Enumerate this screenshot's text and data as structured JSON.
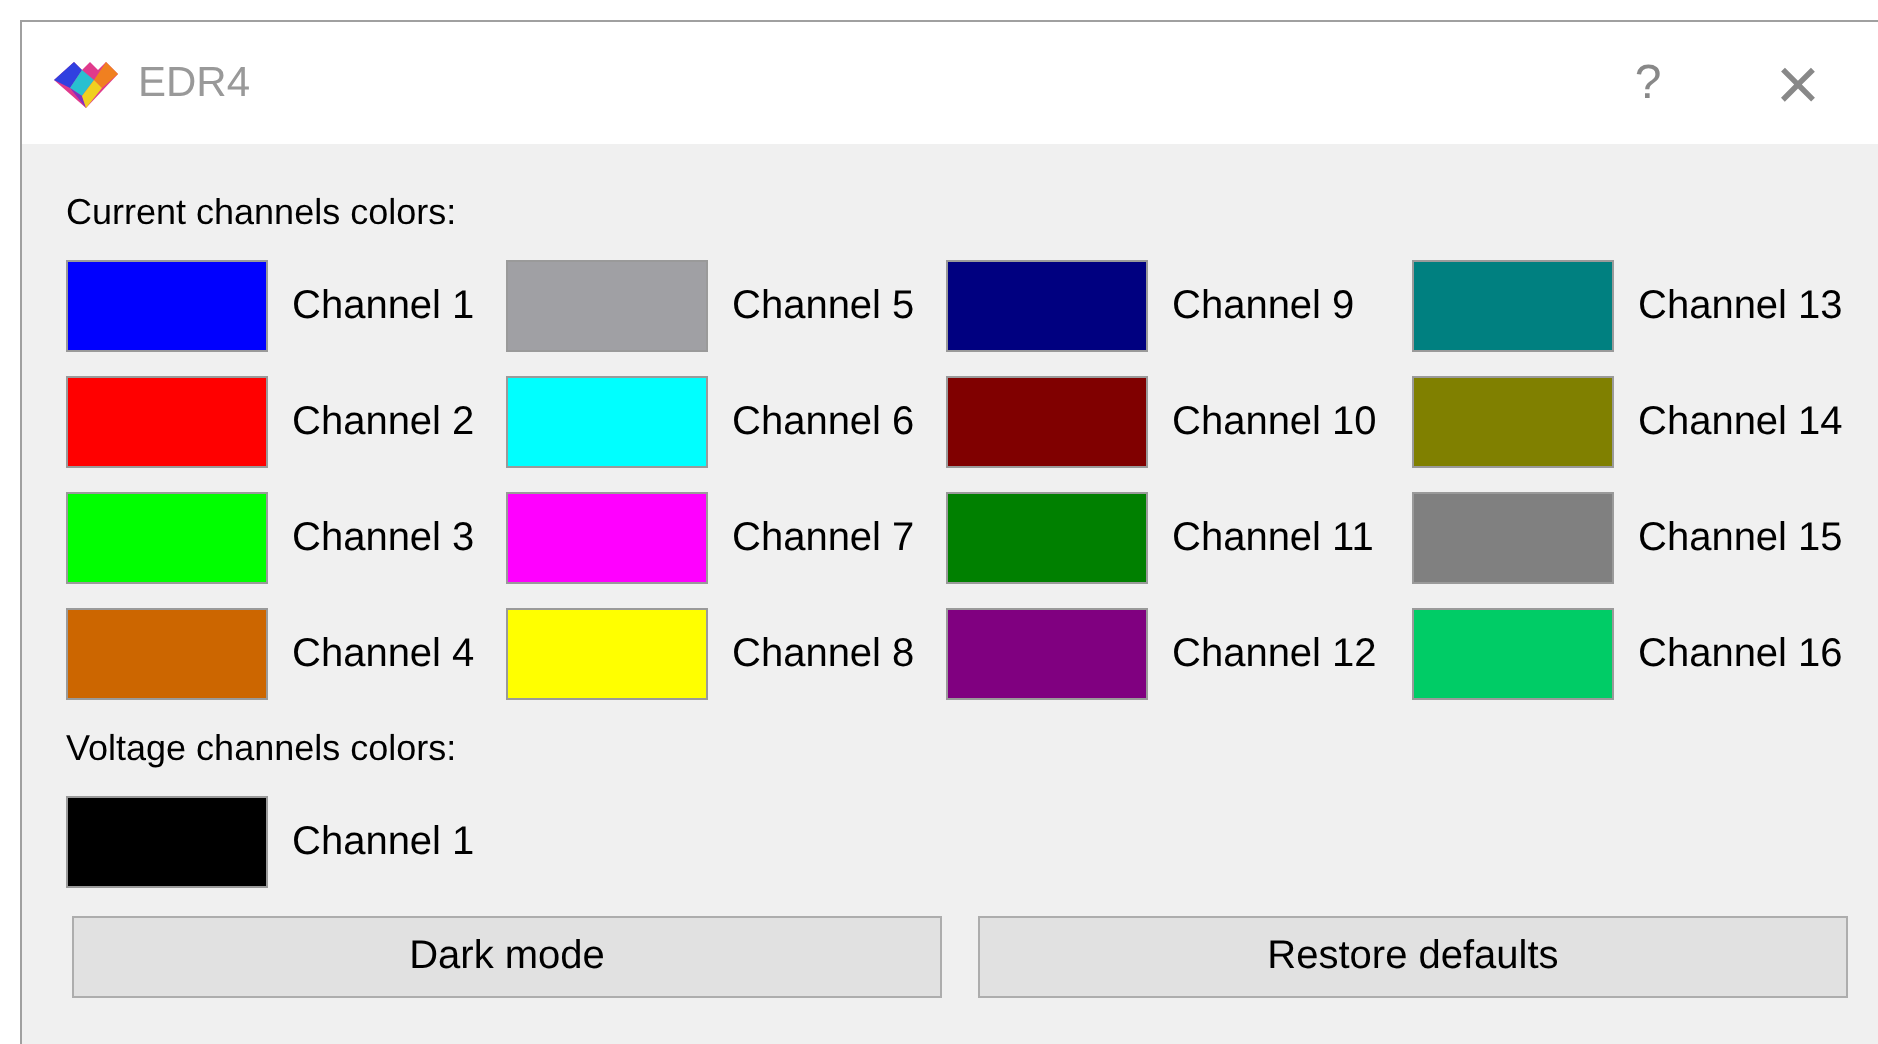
{
  "window": {
    "title": "EDR4",
    "help": "?",
    "close": "×"
  },
  "current_section": {
    "label": "Current channels colors:",
    "channels": [
      {
        "name": "Channel 1",
        "color": "#0000ff"
      },
      {
        "name": "Channel 2",
        "color": "#ff0000"
      },
      {
        "name": "Channel 3",
        "color": "#00ff00"
      },
      {
        "name": "Channel 4",
        "color": "#cc6600"
      },
      {
        "name": "Channel 5",
        "color": "#a0a0a4"
      },
      {
        "name": "Channel 6",
        "color": "#00ffff"
      },
      {
        "name": "Channel 7",
        "color": "#ff00ff"
      },
      {
        "name": "Channel 8",
        "color": "#ffff00"
      },
      {
        "name": "Channel 9",
        "color": "#000080"
      },
      {
        "name": "Channel 10",
        "color": "#800000"
      },
      {
        "name": "Channel 11",
        "color": "#008000"
      },
      {
        "name": "Channel 12",
        "color": "#800080"
      },
      {
        "name": "Channel 13",
        "color": "#008080"
      },
      {
        "name": "Channel 14",
        "color": "#808000"
      },
      {
        "name": "Channel 15",
        "color": "#808080"
      },
      {
        "name": "Channel 16",
        "color": "#00cc66"
      }
    ]
  },
  "voltage_section": {
    "label": "Voltage channels colors:",
    "channels": [
      {
        "name": "Channel 1",
        "color": "#000000"
      }
    ]
  },
  "buttons": [
    "Dark mode",
    "Restore defaults"
  ]
}
